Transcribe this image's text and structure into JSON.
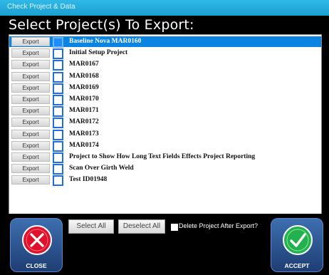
{
  "window": {
    "title": "Check Project & Data"
  },
  "heading": "Select Project(s) To Export:",
  "export_label": "Export",
  "projects": [
    {
      "name": "Baseline Nova MAR0160",
      "selected": true
    },
    {
      "name": "Initial Setup Project",
      "selected": false
    },
    {
      "name": "MAR0167",
      "selected": false
    },
    {
      "name": "MAR0168",
      "selected": false
    },
    {
      "name": "MAR0169",
      "selected": false
    },
    {
      "name": "MAR0170",
      "selected": false
    },
    {
      "name": "MAR0171",
      "selected": false
    },
    {
      "name": "MAR0172",
      "selected": false
    },
    {
      "name": "MAR0173",
      "selected": false
    },
    {
      "name": "MAR0174",
      "selected": false
    },
    {
      "name": "Project to Show How Long Text Fields Effects Project Reporting",
      "selected": false
    },
    {
      "name": "Scan Over Girth Weld",
      "selected": false
    },
    {
      "name": "Test ID01948",
      "selected": false
    }
  ],
  "buttons": {
    "select_all": "Select All",
    "deselect_all": "Deselect All",
    "close": "CLOSE",
    "accept": "ACCEPT"
  },
  "delete_after_export": {
    "label": "Delete Project After Export?",
    "checked": false
  },
  "icons": {
    "close": "x-circle-icon",
    "accept": "check-circle-icon"
  },
  "colors": {
    "selected_row": "#0a84e0",
    "title_bar": "#1ea8dc",
    "close_icon": "#e0112b",
    "accept_icon": "#22b14c"
  }
}
